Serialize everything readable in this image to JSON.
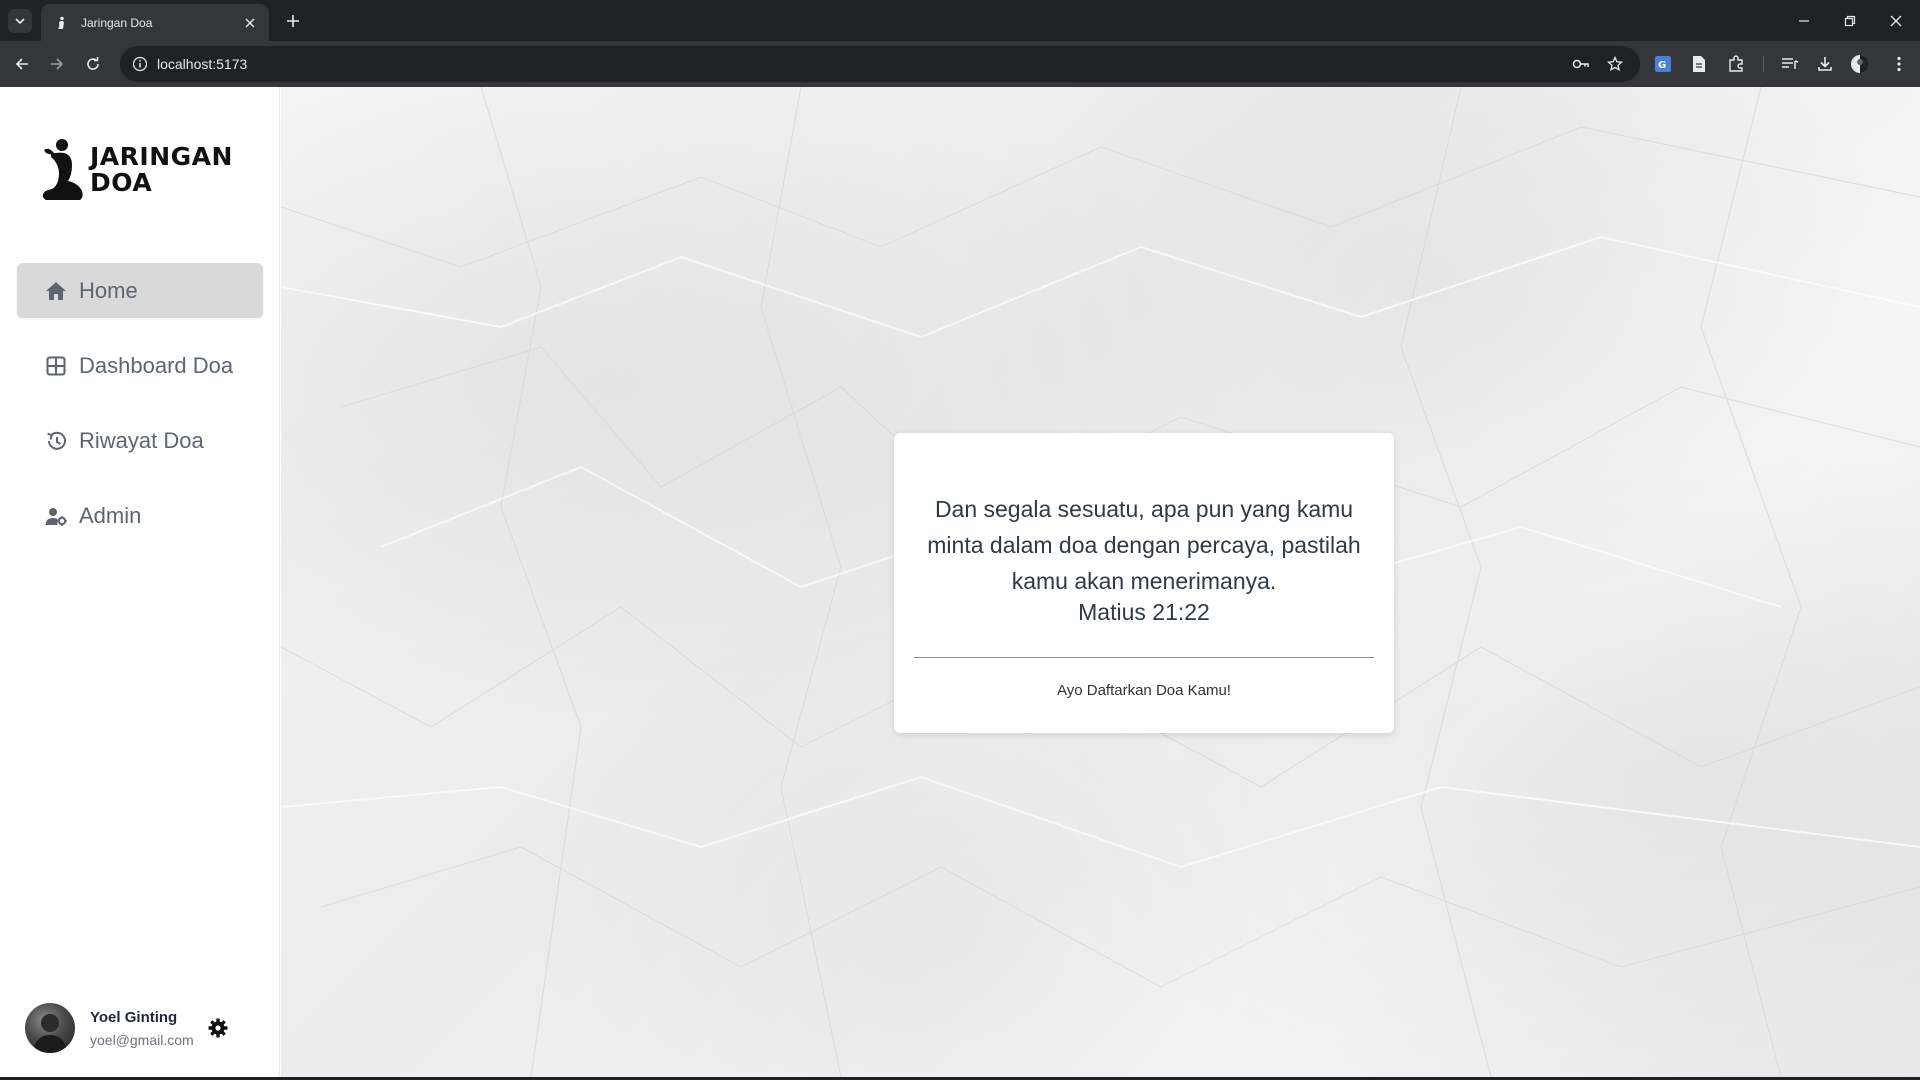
{
  "browser": {
    "tab_title": "Jaringan Doa",
    "url": "localhost:5173"
  },
  "app": {
    "logo_line1": "JARINGAN",
    "logo_line2": "DOA"
  },
  "sidebar": {
    "items": [
      {
        "label": "Home",
        "icon": "home-icon",
        "active": true
      },
      {
        "label": "Dashboard Doa",
        "icon": "dashboard-icon",
        "active": false
      },
      {
        "label": "Riwayat Doa",
        "icon": "history-icon",
        "active": false
      },
      {
        "label": "Admin",
        "icon": "admin-icon",
        "active": false
      }
    ]
  },
  "user": {
    "name": "Yoel Ginting",
    "email": "yoel@gmail.com"
  },
  "card": {
    "verse": "Dan segala sesuatu, apa pun yang kamu minta dalam doa dengan percaya, pastilah kamu akan menerimanya.",
    "reference": "Matius 21:22",
    "cta": "Ayo Daftarkan Doa Kamu!"
  },
  "colors": {
    "active_nav_bg": "#d9d9d9",
    "nav_text": "#5c6672",
    "chrome_dark": "#202124",
    "chrome_toolbar": "#35363a"
  }
}
